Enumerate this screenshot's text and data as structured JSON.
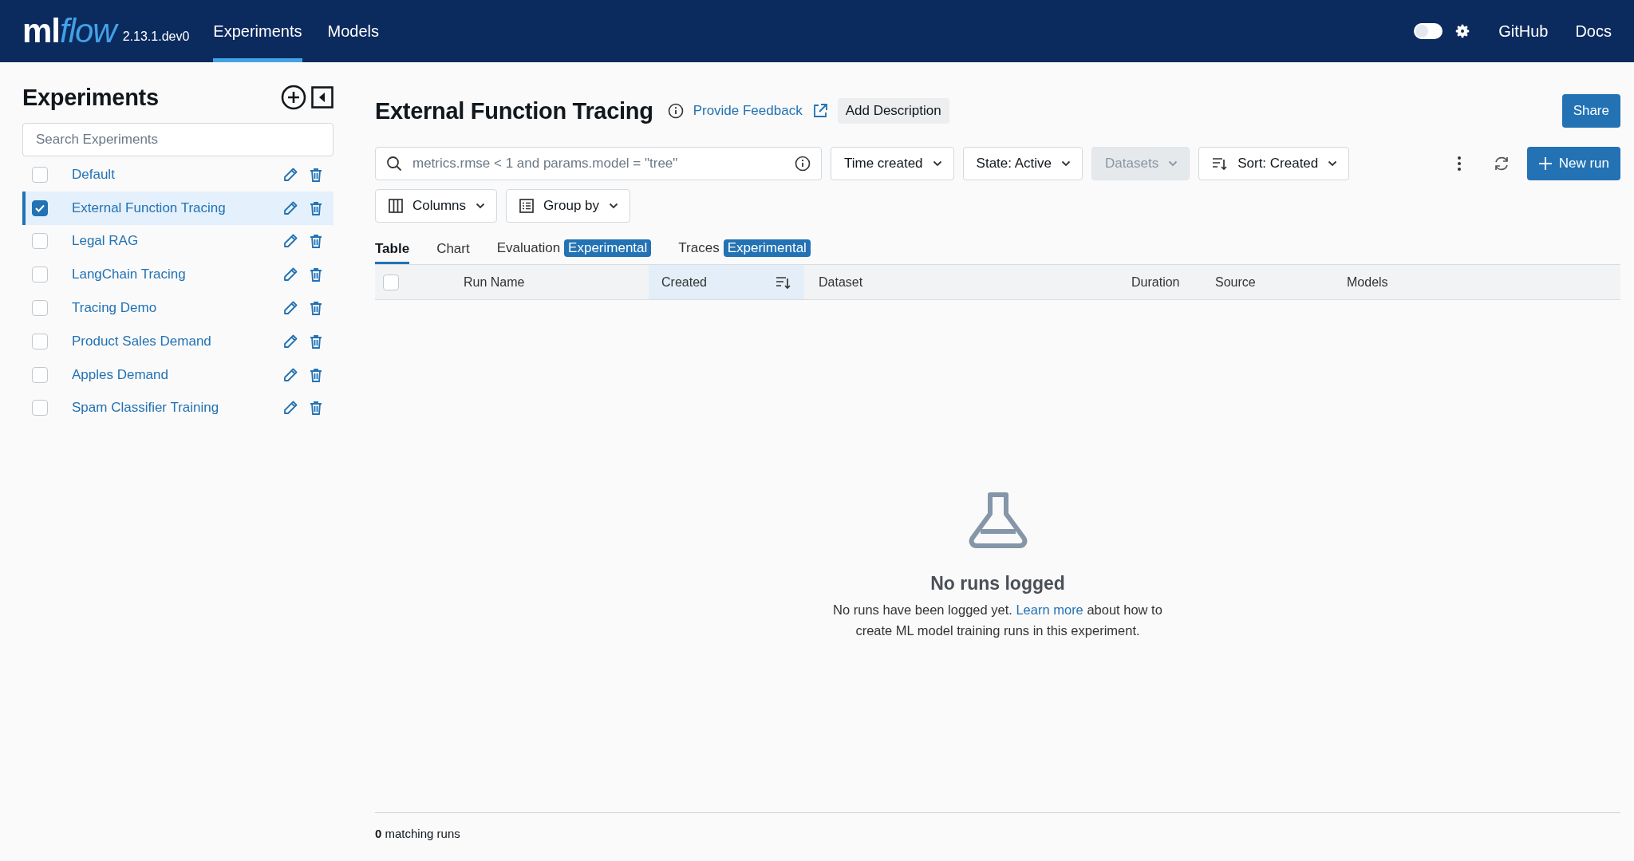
{
  "header": {
    "logo": {
      "plain": "ml",
      "italic": "flow"
    },
    "version": "2.13.1.dev0",
    "nav": [
      {
        "label": "Experiments",
        "selected": true
      },
      {
        "label": "Models",
        "selected": false
      }
    ],
    "theme_toggle": {
      "on": false
    },
    "links": [
      "GitHub",
      "Docs"
    ]
  },
  "sidebar": {
    "title": "Experiments",
    "search": {
      "placeholder": "Search Experiments"
    },
    "experiments": [
      {
        "name": "Default",
        "checked": false,
        "selected": false
      },
      {
        "name": "External Function Tracing",
        "checked": true,
        "selected": true
      },
      {
        "name": "Legal RAG",
        "checked": false,
        "selected": false
      },
      {
        "name": "LangChain Tracing",
        "checked": false,
        "selected": false
      },
      {
        "name": "Tracing Demo",
        "checked": false,
        "selected": false
      },
      {
        "name": "Product Sales Demand",
        "checked": false,
        "selected": false
      },
      {
        "name": "Apples Demand",
        "checked": false,
        "selected": false
      },
      {
        "name": "Spam Classifier Training",
        "checked": false,
        "selected": false
      }
    ]
  },
  "main": {
    "title": "External Function Tracing",
    "feedback_link": "Provide Feedback",
    "add_description": "Add Description",
    "share": "Share",
    "search": {
      "placeholder": "metrics.rmse < 1 and params.model = \"tree\""
    },
    "filters": [
      {
        "label": "Time created",
        "kind": "dropdown",
        "disabled": false
      },
      {
        "label": "State: Active",
        "kind": "dropdown",
        "disabled": false
      },
      {
        "label": "Datasets",
        "kind": "dropdown",
        "disabled": true
      },
      {
        "label": "Sort: Created",
        "kind": "sort",
        "disabled": false
      }
    ],
    "new_run": "New run",
    "view_controls": [
      {
        "label": "Columns",
        "kind": "columns"
      },
      {
        "label": "Group by",
        "kind": "group"
      }
    ],
    "tabs": [
      {
        "label": "Table",
        "selected": true
      },
      {
        "label": "Chart",
        "selected": false
      },
      {
        "label": "Evaluation",
        "badge": "Experimental",
        "selected": false
      },
      {
        "label": "Traces",
        "badge": "Experimental",
        "selected": false
      }
    ],
    "select_all": {
      "checked": false
    },
    "columns": [
      {
        "label": "Run Name",
        "sorted": false
      },
      {
        "label": "Created",
        "sorted": true
      },
      {
        "label": "Dataset",
        "sorted": false
      },
      {
        "label": "Duration",
        "sorted": false
      },
      {
        "label": "Source",
        "sorted": false
      },
      {
        "label": "Models",
        "sorted": false
      }
    ],
    "empty_state": {
      "title": "No runs logged",
      "message_before": "No runs have been logged yet.",
      "link": "Learn more",
      "message_after": "about how to create ML model training runs in this experiment."
    },
    "footer": "**0** matching runs"
  }
}
